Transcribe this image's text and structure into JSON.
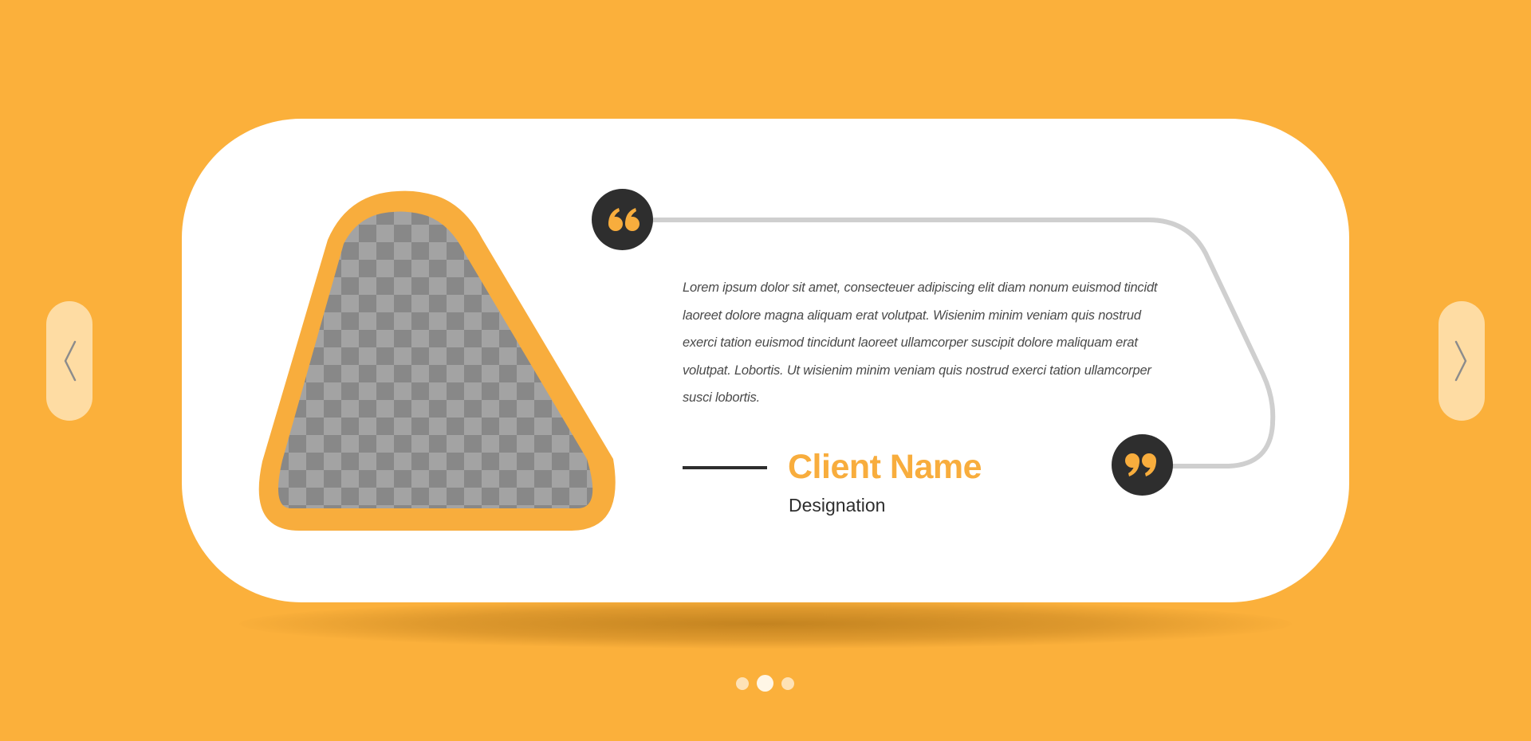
{
  "testimonial": {
    "quote": "Lorem ipsum dolor sit amet, consecteuer adipiscing elit diam nonum euismod tincidt laoreet dolore magna aliquam erat volutpat. Wisienim minim veniam quis nostrud exerci tation euismod tincidunt laoreet ullamcorper suscipit dolore maliquam erat volutpat. Lobortis. Ut wisienim minim veniam quis nostrud exerci tation ullamcorper susci lobortis.",
    "client_name": "Client Name",
    "designation": "Designation",
    "photo": "image-placeholder-checkerboard"
  },
  "navigation": {
    "prev_icon": "chevron-left-icon",
    "next_icon": "chevron-right-icon"
  },
  "pagination": {
    "total": 3,
    "active_index": 1
  },
  "icons": {
    "open_quote": "open-quote-icon",
    "close_quote": "close-quote-icon"
  },
  "colors": {
    "background": "#FBB03B",
    "accent": "#F8AD3D",
    "card": "#FFFFFF",
    "dark": "#2E2E2E",
    "nav_button": "#FEDCA3",
    "connector_line": "#CFCFCF"
  }
}
